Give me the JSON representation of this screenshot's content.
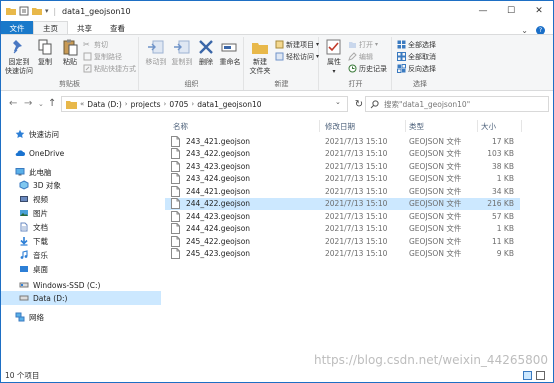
{
  "window": {
    "title": "data1_geojson10"
  },
  "tabs": [
    "文件",
    "主页",
    "共享",
    "查看"
  ],
  "ribbon": {
    "clipboard": {
      "pin": "固定到\n快速访问",
      "copy": "复制",
      "paste": "粘贴",
      "cut": "剪切",
      "copy_path": "复制路径",
      "paste_shortcut": "粘贴快捷方式",
      "label": "剪贴板"
    },
    "organize": {
      "move_to": "移动到",
      "copy_to": "复制到",
      "delete": "删除",
      "rename": "重命名",
      "label": "组织"
    },
    "new": {
      "new_folder": "新建\n文件夹",
      "new_item": "新建项目",
      "easy_access": "轻松访问",
      "label": "新建"
    },
    "open": {
      "properties": "属性",
      "open": "打开",
      "edit": "编辑",
      "history": "历史记录",
      "label": "打开"
    },
    "select": {
      "select_all": "全部选择",
      "select_none": "全部取消",
      "invert": "反向选择",
      "label": "选择"
    }
  },
  "address": {
    "crumbs": [
      "Data (D:)",
      "projects",
      "0705",
      "data1_geojson10"
    ],
    "search_placeholder": "搜索\"data1_geojson10\""
  },
  "nav": {
    "items": [
      "快速访问",
      "OneDrive",
      "此电脑",
      "3D 对象",
      "视频",
      "图片",
      "文档",
      "下载",
      "音乐",
      "桌面",
      "Windows-SSD (C:)",
      "Data (D:)",
      "网络"
    ]
  },
  "columns": {
    "name": "名称",
    "date": "修改日期",
    "type": "类型",
    "size": "大小"
  },
  "files": [
    {
      "name": "243_421.geojson",
      "date": "2021/7/13 15:10",
      "type": "GEOJSON 文件",
      "size": "17 KB"
    },
    {
      "name": "243_422.geojson",
      "date": "2021/7/13 15:10",
      "type": "GEOJSON 文件",
      "size": "103 KB"
    },
    {
      "name": "243_423.geojson",
      "date": "2021/7/13 15:10",
      "type": "GEOJSON 文件",
      "size": "38 KB"
    },
    {
      "name": "243_424.geojson",
      "date": "2021/7/13 15:10",
      "type": "GEOJSON 文件",
      "size": "1 KB"
    },
    {
      "name": "244_421.geojson",
      "date": "2021/7/13 15:10",
      "type": "GEOJSON 文件",
      "size": "34 KB"
    },
    {
      "name": "244_422.geojson",
      "date": "2021/7/13 15:10",
      "type": "GEOJSON 文件",
      "size": "216 KB"
    },
    {
      "name": "244_423.geojson",
      "date": "2021/7/13 15:10",
      "type": "GEOJSON 文件",
      "size": "57 KB"
    },
    {
      "name": "244_424.geojson",
      "date": "2021/7/13 15:10",
      "type": "GEOJSON 文件",
      "size": "1 KB"
    },
    {
      "name": "245_422.geojson",
      "date": "2021/7/13 15:10",
      "type": "GEOJSON 文件",
      "size": "11 KB"
    },
    {
      "name": "245_423.geojson",
      "date": "2021/7/13 15:10",
      "type": "GEOJSON 文件",
      "size": "9 KB"
    }
  ],
  "status": {
    "count": "10 个项目"
  },
  "watermark": "https://blog.csdn.net/weixin_44265800"
}
